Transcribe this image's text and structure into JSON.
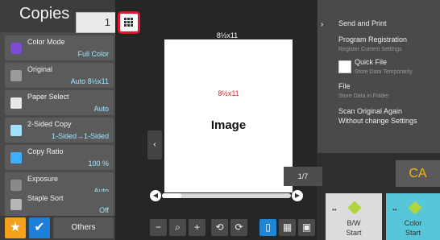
{
  "header": {
    "title": "Copies",
    "copies_value": "1"
  },
  "settings": [
    {
      "label": "Color Mode",
      "value": "Full Color",
      "icon": "color-mode-icon",
      "color": "#7b4bd1"
    },
    {
      "label": "Original",
      "value": "Auto 8½x11",
      "icon": "original-icon",
      "color": "#9a9a9a"
    },
    {
      "label": "Paper Select",
      "value": "Auto",
      "icon": "paper-icon",
      "color": "#e8e8e8"
    },
    {
      "label": "2-Sided Copy",
      "value": "1-Sided→1-Sided",
      "icon": "duplex-icon",
      "color": "#9fe0ff"
    },
    {
      "label": "Copy Ratio",
      "value": "100 %",
      "icon": "ratio-icon",
      "color": "#3cb0ff"
    },
    {
      "label": "Exposure",
      "value": "Auto",
      "icon": "exposure-icon",
      "color": "#8a8a8a"
    },
    {
      "label": "Staple Sort",
      "value": "Off",
      "icon": "staple-icon",
      "color": "#b6b6b6"
    }
  ],
  "bottom": {
    "others_label": "Others",
    "star": "★",
    "check": "✔"
  },
  "preview": {
    "paper_size_top": "8½x11",
    "paper_size_red": "8½x11",
    "image_label": "Image",
    "page_counter": "1/7"
  },
  "toolbar": {
    "zoom_out": "−",
    "zoom": "⌕",
    "zoom_in": "+",
    "rotate_left": "⟲",
    "rotate_right": "⟳"
  },
  "right_panel": {
    "send_and_print": "Send and Print",
    "program_registration": "Program Registration",
    "register_current": "Register Current Settings",
    "quick_file": "Quick File",
    "store_temporarily": "Store Data Temporarily",
    "file": "File",
    "store_in_folder": "Store Data in Folder",
    "scan_again_line1": "Scan Original Again",
    "scan_again_line2": "Without change Settings"
  },
  "ca": "CA",
  "start": {
    "bw_line1": "B/W",
    "bw_line2": "Start",
    "color_line1": "Color",
    "color_line2": "Start"
  }
}
